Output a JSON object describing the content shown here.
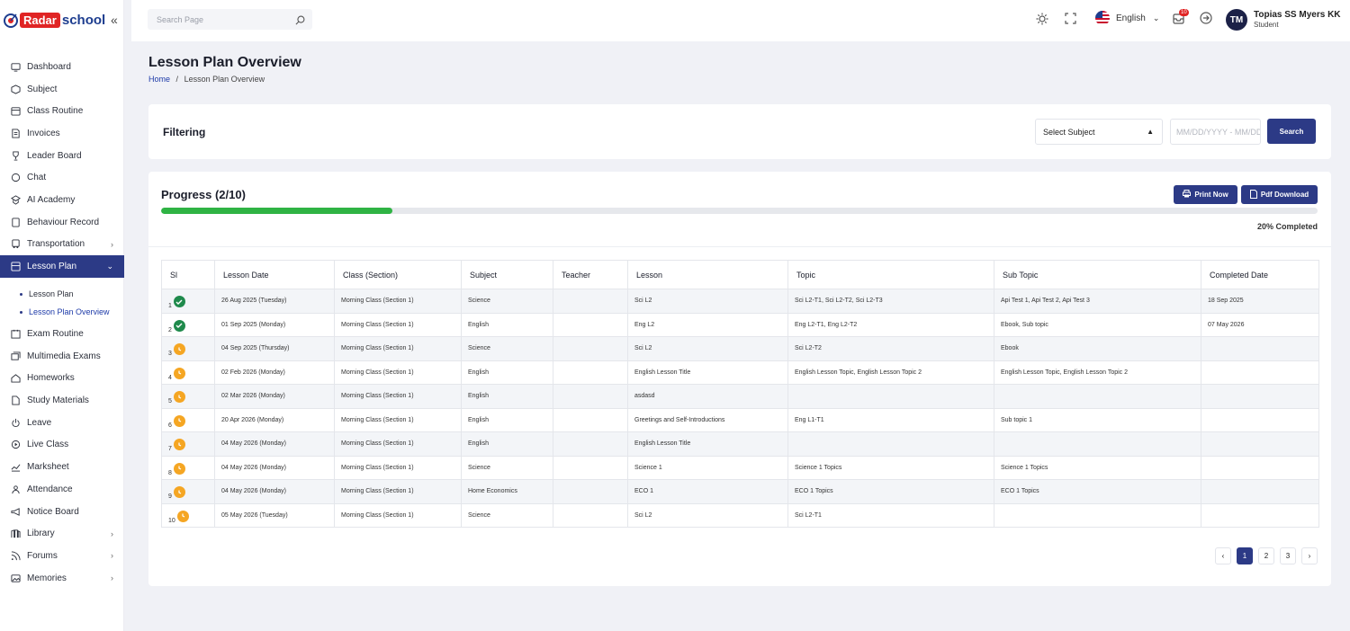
{
  "brand": {
    "logo_radar": "Radar",
    "logo_school": "school"
  },
  "search": {
    "placeholder": "Search Page"
  },
  "header": {
    "language": "English",
    "notification_count": "10",
    "user_initials": "TM",
    "user_name": "Topias SS Myers KK",
    "user_role": "Student"
  },
  "sidebar": {
    "items": [
      {
        "label": "Dashboard",
        "icon": "monitor-icon"
      },
      {
        "label": "Subject",
        "icon": "box-icon"
      },
      {
        "label": "Class Routine",
        "icon": "calendar-icon"
      },
      {
        "label": "Invoices",
        "icon": "invoice-icon"
      },
      {
        "label": "Leader Board",
        "icon": "trophy-icon"
      },
      {
        "label": "Chat",
        "icon": "chat-icon"
      },
      {
        "label": "AI Academy",
        "icon": "ai-icon"
      },
      {
        "label": "Behaviour Record",
        "icon": "record-icon"
      },
      {
        "label": "Transportation",
        "icon": "bus-icon",
        "has_children": true
      },
      {
        "label": "Lesson Plan",
        "icon": "lesson-icon",
        "has_children": true,
        "active": true
      }
    ],
    "lesson_plan_children": [
      {
        "label": "Lesson Plan"
      },
      {
        "label": "Lesson Plan Overview",
        "current": true
      }
    ],
    "items_after": [
      {
        "label": "Exam Routine",
        "icon": "exam-icon"
      },
      {
        "label": "Multimedia Exams",
        "icon": "media-icon"
      },
      {
        "label": "Homeworks",
        "icon": "home-icon"
      },
      {
        "label": "Study Materials",
        "icon": "document-icon"
      },
      {
        "label": "Leave",
        "icon": "power-icon"
      },
      {
        "label": "Live Class",
        "icon": "video-icon"
      },
      {
        "label": "Marksheet",
        "icon": "marksheet-icon"
      },
      {
        "label": "Attendance",
        "icon": "attendance-icon"
      },
      {
        "label": "Notice Board",
        "icon": "megaphone-icon"
      },
      {
        "label": "Library",
        "icon": "library-icon",
        "has_children": true
      },
      {
        "label": "Forums",
        "icon": "rss-icon",
        "has_children": true
      },
      {
        "label": "Memories",
        "icon": "image-icon",
        "has_children": true
      }
    ]
  },
  "page": {
    "title": "Lesson Plan Overview",
    "breadcrumb_home": "Home",
    "breadcrumb_sep": "/",
    "breadcrumb_current": "Lesson Plan Overview"
  },
  "filter": {
    "title": "Filtering",
    "subject_select": "Select Subject",
    "date_placeholder": "MM/DD/YYYY - MM/DD",
    "search_label": "Search"
  },
  "progress": {
    "title": "Progress (2/10)",
    "fraction": 0.2,
    "completed_label": "20% Completed",
    "print_label": "Print Now",
    "pdf_label": "Pdf Download",
    "color": "#2fb344"
  },
  "table": {
    "columns": [
      "Sl",
      "Lesson Date",
      "Class (Section)",
      "Subject",
      "Teacher",
      "Lesson",
      "Topic",
      "Sub Topic",
      "Completed Date"
    ],
    "rows": [
      {
        "sl": "1",
        "status": "done",
        "date": "26 Aug 2025 (Tuesday)",
        "class": "Morning Class (Section 1)",
        "subject": "Science",
        "teacher": "",
        "lesson": "Sci L2",
        "topic": "Sci L2-T1, Sci L2-T2, Sci L2-T3",
        "subtopic": "Api Test 1, Api Test 2, Api Test 3",
        "completed": "18 Sep 2025"
      },
      {
        "sl": "2",
        "status": "done",
        "date": "01 Sep 2025 (Monday)",
        "class": "Morning Class (Section 1)",
        "subject": "English",
        "teacher": "",
        "lesson": "Eng L2",
        "topic": "Eng L2-T1, Eng L2-T2",
        "subtopic": "Ebook, Sub topic",
        "completed": "07 May 2026"
      },
      {
        "sl": "3",
        "status": "pending",
        "date": "04 Sep 2025 (Thursday)",
        "class": "Morning Class (Section 1)",
        "subject": "Science",
        "teacher": "",
        "lesson": "Sci L2",
        "topic": "Sci L2-T2",
        "subtopic": "Ebook",
        "completed": ""
      },
      {
        "sl": "4",
        "status": "pending",
        "date": "02 Feb 2026 (Monday)",
        "class": "Morning Class (Section 1)",
        "subject": "English",
        "teacher": "",
        "lesson": "English Lesson Title",
        "topic": "English Lesson Topic, English Lesson Topic 2",
        "subtopic": "English Lesson Topic, English Lesson Topic 2",
        "completed": ""
      },
      {
        "sl": "5",
        "status": "pending",
        "date": "02 Mar 2026 (Monday)",
        "class": "Morning Class (Section 1)",
        "subject": "English",
        "teacher": "",
        "lesson": "asdasd",
        "topic": "",
        "subtopic": "",
        "completed": ""
      },
      {
        "sl": "6",
        "status": "pending",
        "date": "20 Apr 2026 (Monday)",
        "class": "Morning Class (Section 1)",
        "subject": "English",
        "teacher": "",
        "lesson": "Greetings and Self-Introductions",
        "topic": "Eng L1-T1",
        "subtopic": "Sub topic 1",
        "completed": ""
      },
      {
        "sl": "7",
        "status": "pending",
        "date": "04 May 2026 (Monday)",
        "class": "Morning Class (Section 1)",
        "subject": "English",
        "teacher": "",
        "lesson": "English Lesson Title",
        "topic": "",
        "subtopic": "",
        "completed": ""
      },
      {
        "sl": "8",
        "status": "pending",
        "date": "04 May 2026 (Monday)",
        "class": "Morning Class (Section 1)",
        "subject": "Science",
        "teacher": "",
        "lesson": "Science 1",
        "topic": "Science 1 Topics",
        "subtopic": "Science 1 Topics",
        "completed": ""
      },
      {
        "sl": "9",
        "status": "pending",
        "date": "04 May 2026 (Monday)",
        "class": "Morning Class (Section 1)",
        "subject": "Home Economics",
        "teacher": "",
        "lesson": "ECO 1",
        "topic": "ECO 1 Topics",
        "subtopic": "ECO 1 Topics",
        "completed": ""
      },
      {
        "sl": "10",
        "status": "pending",
        "date": "05 May 2026 (Tuesday)",
        "class": "Morning Class (Section 1)",
        "subject": "Science",
        "teacher": "",
        "lesson": "Sci L2",
        "topic": "Sci L2-T1",
        "subtopic": "",
        "completed": ""
      }
    ]
  },
  "pagination": {
    "prev": "‹",
    "pages": [
      "1",
      "2",
      "3"
    ],
    "current": "1",
    "next": "›"
  },
  "colors": {
    "accent": "#2c3a86",
    "done": "#1f8a4c",
    "pending": "#f5a623",
    "alert": "#e02424"
  }
}
